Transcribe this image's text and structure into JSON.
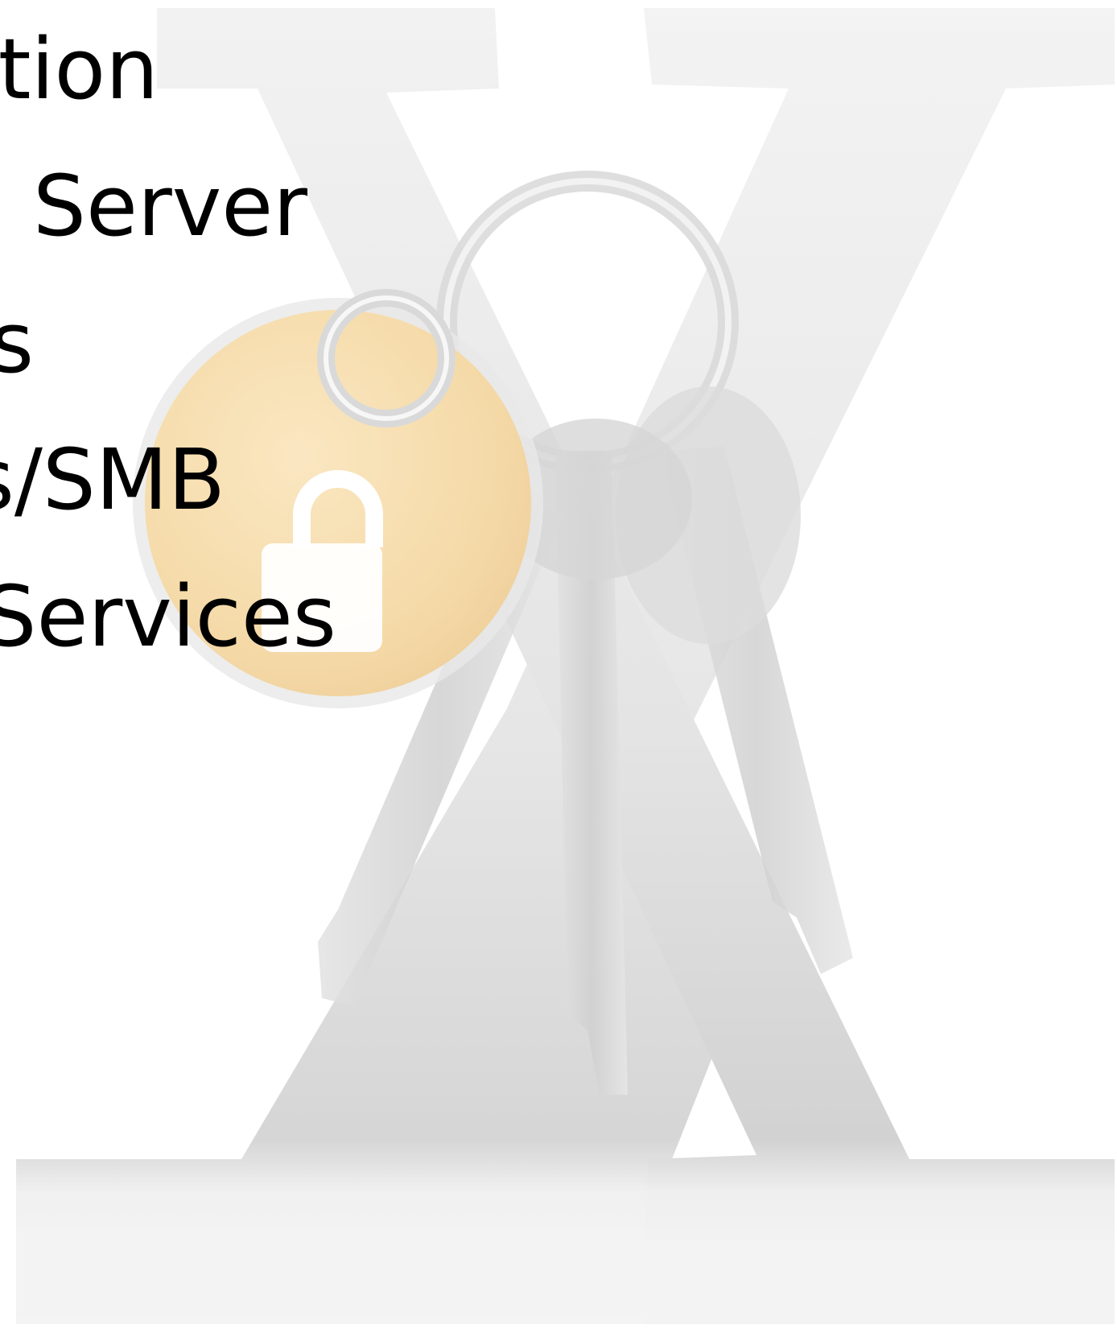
{
  "colors": {
    "background": "#ffffff",
    "text": "#000000",
    "x_logo": "#e3e3e3",
    "keyring": "#dcdcdc",
    "key_tag": "#f7dca6",
    "lock": "#ffffff"
  },
  "icons": [
    "macos-x-logo-icon",
    "keychain-icon",
    "lock-icon"
  ],
  "menu": {
    "items": [
      {
        "label": "ction"
      },
      {
        "label": "rd Server"
      },
      {
        "label": "s"
      },
      {
        "label": "s/SMB"
      },
      {
        "label": "k Services"
      }
    ]
  }
}
